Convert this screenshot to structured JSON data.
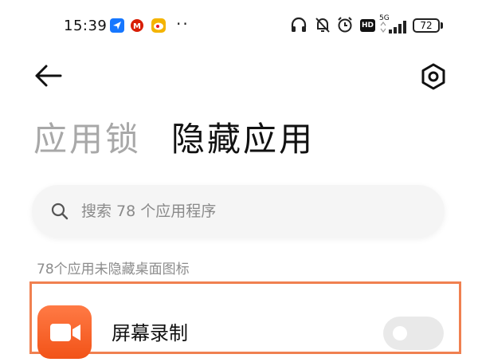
{
  "status_bar": {
    "time": "15:39",
    "network_label": "5G",
    "battery": "72"
  },
  "header": {
    "tabs": [
      {
        "label": "应用锁",
        "active": false
      },
      {
        "label": "隐藏应用",
        "active": true
      }
    ]
  },
  "search": {
    "placeholder": "搜索 78 个应用程序"
  },
  "section_label": "78个应用未隐藏桌面图标",
  "apps": [
    {
      "name": "屏幕录制",
      "icon": "video-camera-icon",
      "toggle_on": false
    }
  ],
  "colors": {
    "accent": "#f25318",
    "highlight_border": "#f08050",
    "inactive_tab": "#a8a8a8"
  }
}
